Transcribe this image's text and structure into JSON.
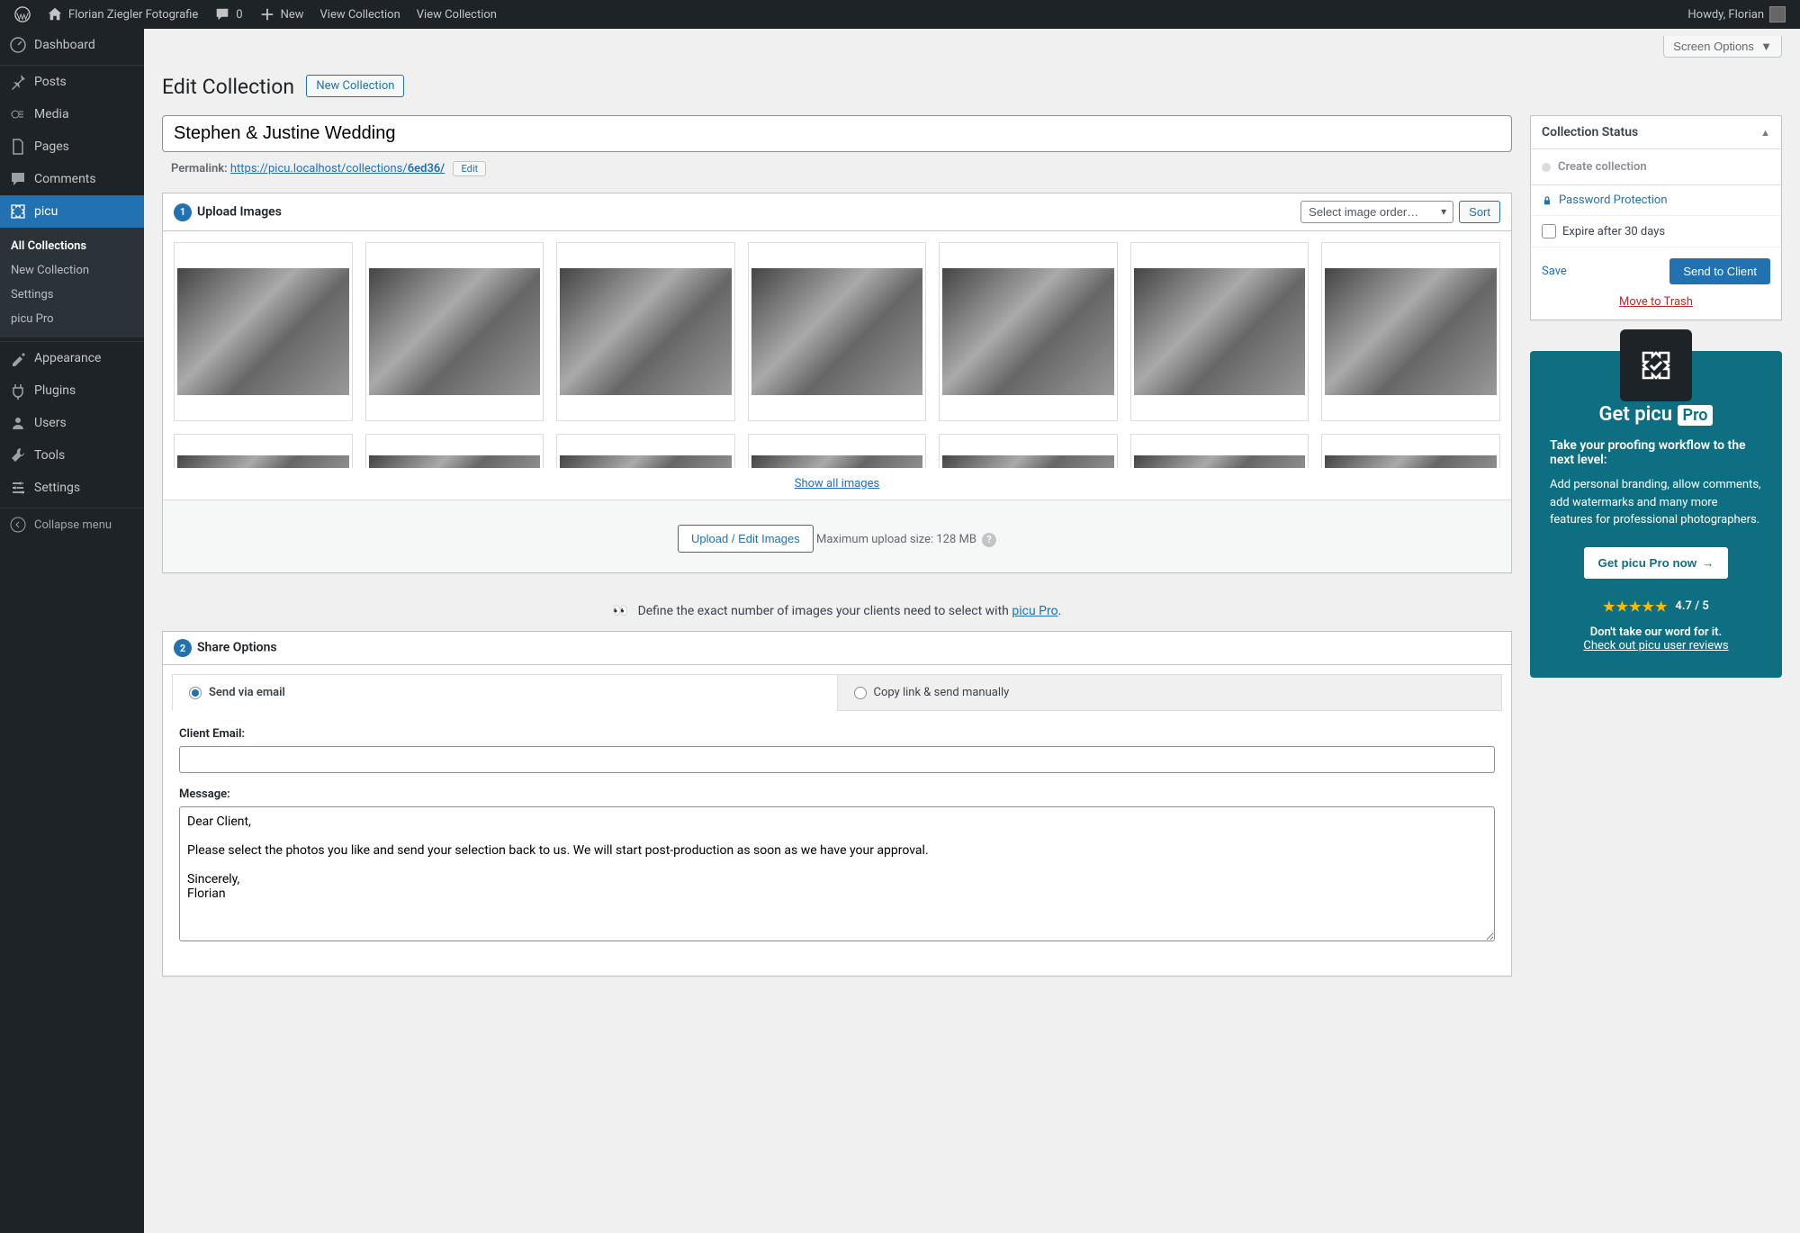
{
  "adminbar": {
    "site_name": "Florian Ziegler Fotografie",
    "comments_count": "0",
    "new_label": "New",
    "view_collection_1": "View Collection",
    "view_collection_2": "View Collection",
    "howdy": "Howdy, Florian"
  },
  "menu": {
    "dashboard": "Dashboard",
    "posts": "Posts",
    "media": "Media",
    "pages": "Pages",
    "comments": "Comments",
    "picu": "picu",
    "picu_sub": {
      "all": "All Collections",
      "new": "New Collection",
      "settings": "Settings",
      "pro": "picu Pro"
    },
    "appearance": "Appearance",
    "plugins": "Plugins",
    "users": "Users",
    "tools": "Tools",
    "settings": "Settings",
    "collapse": "Collapse menu"
  },
  "screen_options": "Screen Options",
  "page": {
    "title": "Edit Collection",
    "new_collection": "New Collection",
    "collection_title": "Stephen & Justine Wedding",
    "permalink_label": "Permalink:",
    "permalink_base": "https://picu.localhost/collections/",
    "permalink_slug": "6ed36/",
    "edit_slug": "Edit"
  },
  "upload": {
    "heading": "Upload Images",
    "select_order": "Select image order…",
    "sort": "Sort",
    "show_all": "Show all images",
    "upload_edit": "Upload / Edit Images",
    "max_size": "Maximum upload size: 128 MB"
  },
  "pro_hint": {
    "emoji": "👀",
    "text": "Define the exact number of images your clients need to select with ",
    "link": "picu Pro"
  },
  "share": {
    "heading": "Share Options",
    "tab_email": "Send via email",
    "tab_copy": "Copy link & send manually",
    "client_email_label": "Client Email:",
    "message_label": "Message:",
    "client_email_value": "",
    "message_value": "Dear Client,\n\nPlease select the photos you like and send your selection back to us. We will start post-production as soon as we have your approval.\n\nSincerely,\nFlorian"
  },
  "status": {
    "heading": "Collection Status",
    "create": "Create collection",
    "password": "Password Protection",
    "expire": "Expire after 30 days",
    "save": "Save",
    "send": "Send to Client",
    "trash": "Move to Trash"
  },
  "promo": {
    "title_a": "Get picu ",
    "title_b": "Pro",
    "lead": "Take your proofing workflow to the next level:",
    "body": "Add personal branding, allow comments, add watermarks and many more features for professional photographers.",
    "cta": "Get picu Pro now",
    "rating": "4.7 / 5",
    "trust": "Don't take our word for it.",
    "reviews": "Check out picu user reviews"
  }
}
